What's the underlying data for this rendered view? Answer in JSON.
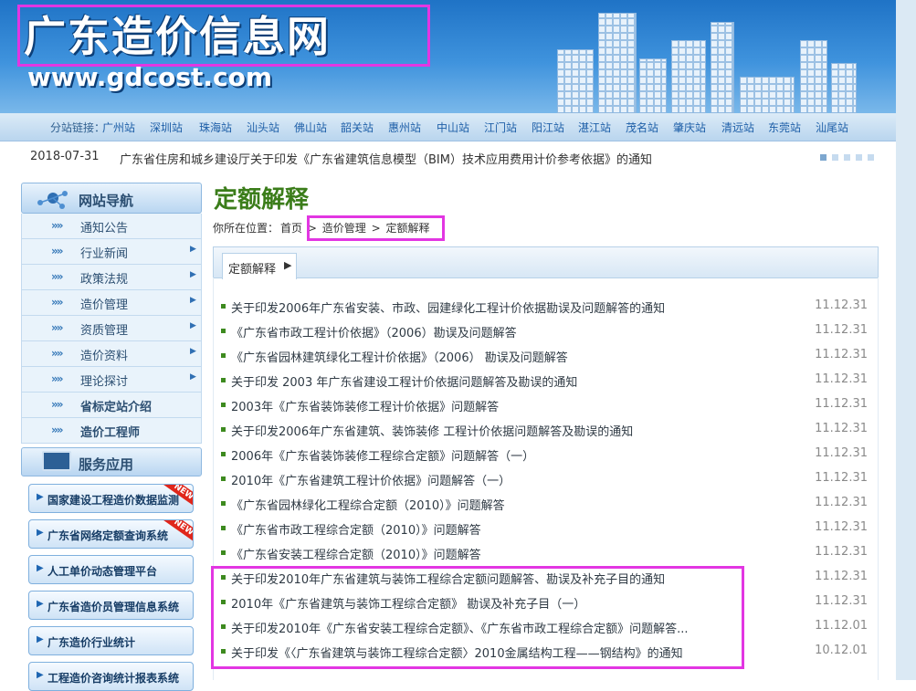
{
  "header": {
    "site_title": "广东造价信息网",
    "site_url": "www.gdcost.com"
  },
  "stations": {
    "label": "分站链接：",
    "items": [
      "广州站",
      "深圳站",
      "珠海站",
      "汕头站",
      "佛山站",
      "韶关站",
      "惠州站",
      "中山站",
      "江门站",
      "阳江站",
      "湛江站",
      "茂名站",
      "肇庆站",
      "清远站",
      "东莞站",
      "汕尾站"
    ]
  },
  "notice": {
    "date": "2018-07-31",
    "text": "广东省住房和城乡建设厅关于印发《广东省建筑信息模型（BIM）技术应用费用计价参考依据》的通知"
  },
  "sidebar": {
    "nav_title": "网站导航",
    "nav_items": [
      {
        "label": "通知公告",
        "arrow": ""
      },
      {
        "label": "行业新闻",
        "arrow": "▶"
      },
      {
        "label": "政策法规",
        "arrow": "▶"
      },
      {
        "label": "造价管理",
        "arrow": "▶"
      },
      {
        "label": "资质管理",
        "arrow": "▶"
      },
      {
        "label": "造价资料",
        "arrow": "▶"
      },
      {
        "label": "理论探讨",
        "arrow": "▶"
      },
      {
        "label": "省标定站介绍",
        "arrow": ""
      },
      {
        "label": "造价工程师",
        "arrow": ""
      }
    ],
    "service_title": "服务应用",
    "service_items": [
      {
        "label": "国家建设工程造价数据监测",
        "tag": "NEW"
      },
      {
        "label": "广东省网络定额查询系统",
        "tag": "NEW"
      },
      {
        "label": "人工单价动态管理平台",
        "tag": ""
      },
      {
        "label": "广东省造价员管理信息系统",
        "tag": ""
      },
      {
        "label": "广东造价行业统计",
        "tag": ""
      },
      {
        "label": "工程造价咨询统计报表系统",
        "tag": ""
      }
    ]
  },
  "main": {
    "page_title": "定额解释",
    "breadcrumb": {
      "prefix": "你所在位置：",
      "home": "首页",
      "sep1": ">",
      "level1": "造价管理",
      "sep2": ">",
      "level2": "定额解释"
    },
    "tab_label": "定额解释",
    "articles": [
      {
        "title": "关于印发2006年广东省安装、市政、园建绿化工程计价依据勘误及问题解答的通知",
        "date": "11.12.31"
      },
      {
        "title": "《广东省市政工程计价依据》（2006）勘误及问题解答",
        "date": "11.12.31"
      },
      {
        "title": "《广东省园林建筑绿化工程计价依据》（2006） 勘误及问题解答",
        "date": "11.12.31"
      },
      {
        "title": "关于印发 2003 年广东省建设工程计价依据问题解答及勘误的通知",
        "date": "11.12.31"
      },
      {
        "title": "2003年《广东省装饰装修工程计价依据》问题解答",
        "date": "11.12.31"
      },
      {
        "title": "关于印发2006年广东省建筑、装饰装修 工程计价依据问题解答及勘误的通知",
        "date": "11.12.31"
      },
      {
        "title": "2006年《广东省装饰装修工程综合定额》问题解答（一）",
        "date": "11.12.31"
      },
      {
        "title": "2010年《广东省建筑工程计价依据》问题解答（一）",
        "date": "11.12.31"
      },
      {
        "title": "《广东省园林绿化工程综合定额（2010）》问题解答",
        "date": "11.12.31"
      },
      {
        "title": "《广东省市政工程综合定额（2010）》问题解答",
        "date": "11.12.31"
      },
      {
        "title": "《广东省安装工程综合定额（2010）》问题解答",
        "date": "11.12.31"
      },
      {
        "title": "关于印发2010年广东省建筑与装饰工程综合定额问题解答、勘误及补充子目的通知",
        "date": "11.12.31"
      },
      {
        "title": "2010年《广东省建筑与装饰工程综合定额》 勘误及补充子目（一）",
        "date": "11.12.31"
      },
      {
        "title": "关于印发2010年《广东省安装工程综合定额》、《广东省市政工程综合定额》问题解答...",
        "date": "11.12.01"
      },
      {
        "title": "关于印发《〈广东省建筑与装饰工程综合定额〉2010金属结构工程——钢结构》的通知",
        "date": "10.12.01"
      }
    ]
  },
  "colors": {
    "accent_green": "#3b7d1a",
    "annotation": "#e236e2",
    "header_blue": "#2a80d0"
  }
}
